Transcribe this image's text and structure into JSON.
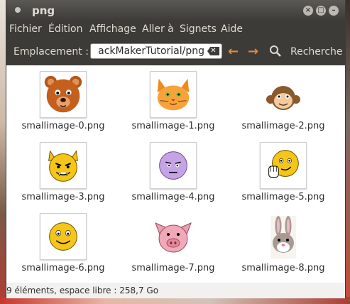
{
  "window": {
    "title": "png"
  },
  "menu": [
    "Fichier",
    "Édition",
    "Affichage",
    "Aller à",
    "Signets",
    "Aide"
  ],
  "toolbar": {
    "location_label": "Emplacement :",
    "location_value": "ackMakerTutorial/png",
    "search_label": "Recherche"
  },
  "files": [
    {
      "name": "smallimage-0.png",
      "icon": "bear-face-icon"
    },
    {
      "name": "smallimage-1.png",
      "icon": "cat-face-icon"
    },
    {
      "name": "smallimage-2.png",
      "icon": "monkey-face-icon"
    },
    {
      "name": "smallimage-3.png",
      "icon": "devil-face-icon"
    },
    {
      "name": "smallimage-4.png",
      "icon": "sad-purple-face-icon"
    },
    {
      "name": "smallimage-5.png",
      "icon": "waving-smiley-icon"
    },
    {
      "name": "smallimage-6.png",
      "icon": "smiley-face-icon"
    },
    {
      "name": "smallimage-7.png",
      "icon": "pig-face-icon"
    },
    {
      "name": "smallimage-8.png",
      "icon": "bunny-face-icon"
    }
  ],
  "status": {
    "text": "9 éléments, espace libre : 258,7 Go"
  },
  "colors": {
    "chrome": "#3c3b37",
    "accent_arrow": "#e38a3a",
    "content_bg": "#ffffff"
  }
}
